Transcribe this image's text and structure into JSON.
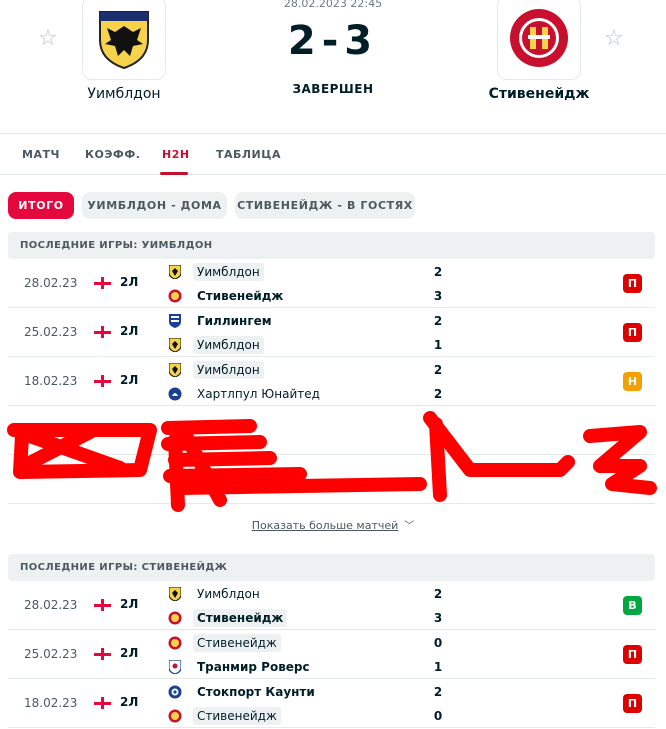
{
  "header": {
    "datetime": "28.02.2023 22:45",
    "home_team": "Уимблдон",
    "away_team": "Стивенейдж",
    "score": "2-3",
    "status": "ЗАВЕРШЕН",
    "home_logo_text": "AFC WIMBLEDON",
    "away_logo_text": "STEVENAGE FOOTBALL CLUB"
  },
  "tabs": [
    {
      "label": "МАТЧ",
      "active": false
    },
    {
      "label": "КОЭФФ.",
      "active": false
    },
    {
      "label": "H2H",
      "active": true
    },
    {
      "label": "ТАБЛИЦА",
      "active": false
    }
  ],
  "filters": [
    {
      "label": "ИТОГО",
      "active": true
    },
    {
      "label": "УИМБЛДОН - ДОМА",
      "active": false
    },
    {
      "label": "СТИВЕНЕЙДЖ - В ГОСТЯХ",
      "active": false
    }
  ],
  "sections": [
    {
      "title": "ПОСЛЕДНИЕ ИГРЫ: УИМБЛДОН",
      "matches": [
        {
          "date": "28.02.23",
          "league": "2Л",
          "team1": "Уимблдон",
          "team1_logo": "wimbledon-logo-icon",
          "score1": "2",
          "team2": "Стивенейдж",
          "team2_logo": "stevenage-logo-icon",
          "score2": "3",
          "result": "П",
          "result_type": "loss"
        },
        {
          "date": "25.02.23",
          "league": "2Л",
          "team1": "Гиллингем",
          "team1_logo": "gillingham-logo-icon",
          "score1": "2",
          "team2": "Уимблдон",
          "team2_logo": "wimbledon-logo-icon",
          "score2": "1",
          "result": "П",
          "result_type": "loss"
        },
        {
          "date": "18.02.23",
          "league": "2Л",
          "team1": "Уимблдон",
          "team1_logo": "wimbledon-logo-icon",
          "score1": "2",
          "team2": "Хартлпул Юнайтед",
          "team2_logo": "hartlepool-logo-icon",
          "score2": "2",
          "result": "Н",
          "result_type": "draw"
        }
      ],
      "show_more": "Показать больше матчей"
    },
    {
      "title": "ПОСЛЕДНИЕ ИГРЫ: СТИВЕНЕЙДЖ",
      "matches": [
        {
          "date": "28.02.23",
          "league": "2Л",
          "team1": "Уимблдон",
          "team1_logo": "wimbledon-logo-icon",
          "score1": "2",
          "team2": "Стивенейдж",
          "team2_logo": "stevenage-logo-icon",
          "score2": "3",
          "result": "В",
          "result_type": "win"
        },
        {
          "date": "25.02.23",
          "league": "2Л",
          "team1": "Стивенейдж",
          "team1_logo": "stevenage-logo-icon",
          "score1": "0",
          "team2": "Транмир Роверс",
          "team2_logo": "tranmere-logo-icon",
          "score2": "1",
          "result": "П",
          "result_type": "loss"
        },
        {
          "date": "18.02.23",
          "league": "2Л",
          "team1": "Стокпорт Каунти",
          "team1_logo": "stockport-logo-icon",
          "score1": "2",
          "team2": "Стивенейдж",
          "team2_logo": "stevenage-logo-icon",
          "score2": "0",
          "result": "П",
          "result_type": "loss"
        }
      ]
    }
  ],
  "colors": {
    "accent": "#e4083f",
    "loss": "#dc0000",
    "draw": "#f3a000",
    "win": "#00a83f",
    "scribble": "#ff0000"
  }
}
